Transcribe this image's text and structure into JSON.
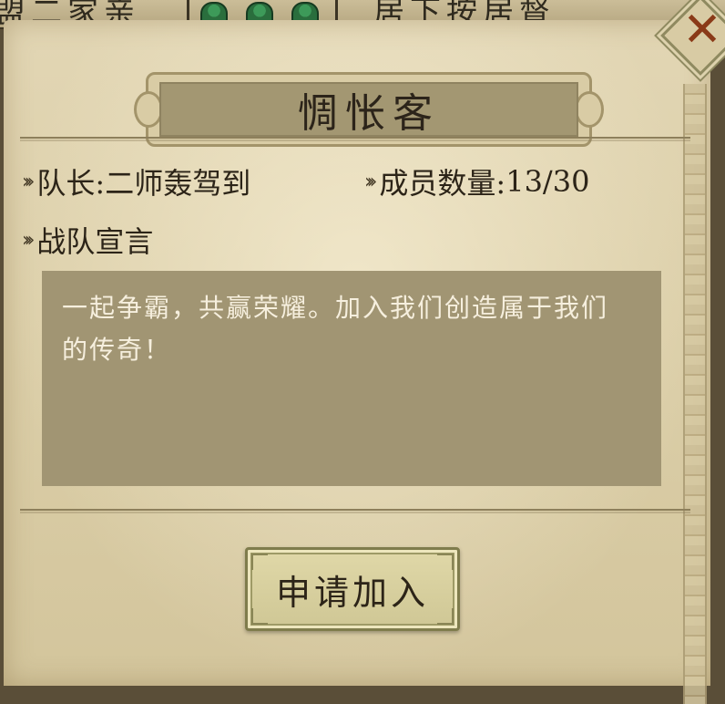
{
  "background": {
    "left_text": "盟二家亲",
    "right_text": "居下按居督"
  },
  "dialog": {
    "title": "惆怅客",
    "close_symbol": "✕",
    "captain_label": "队长:",
    "captain_name": "二师轰驾到",
    "members_label": "成员数量:",
    "members_count": "13/30",
    "declaration_label": "战队宣言",
    "declaration_text": "一起争霸，共赢荣耀。加入我们创造属于我们的传奇！",
    "join_button": "申请加入"
  },
  "colors": {
    "parchment": "#dccfa9",
    "title_bar": "#a39772",
    "declaration_box": "#a19573",
    "close_x": "#8a3a18",
    "button": "#cfc795"
  },
  "icons": {
    "bullet": "double-chevron-right-icon",
    "close": "close-icon"
  }
}
